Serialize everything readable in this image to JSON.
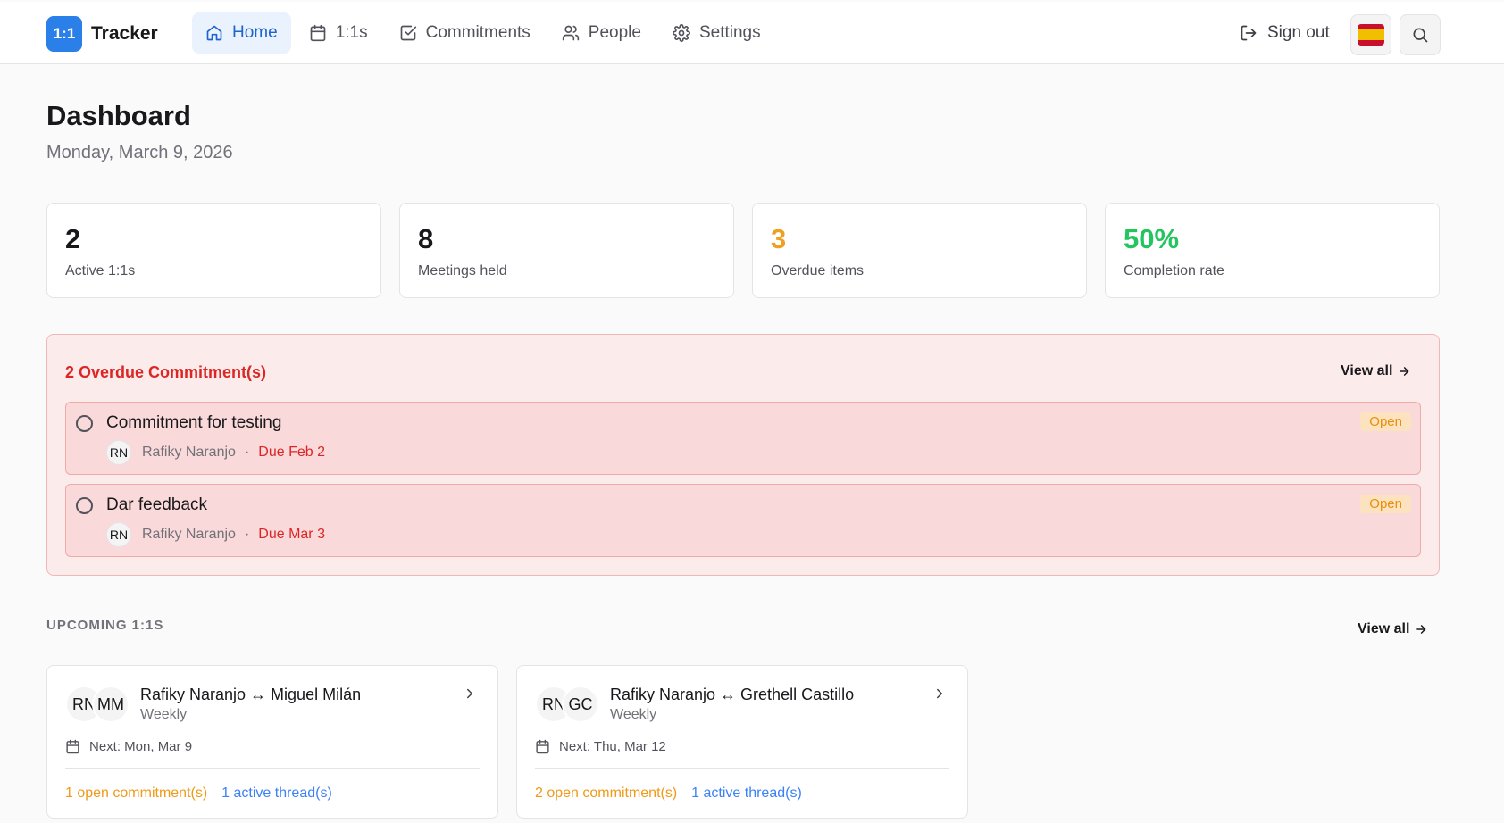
{
  "brand": {
    "logo_text": "1:1",
    "name": "Tracker"
  },
  "nav": [
    {
      "label": "Home",
      "icon": "home-icon",
      "active": true
    },
    {
      "label": "1:1s",
      "icon": "calendar-icon",
      "active": false
    },
    {
      "label": "Commitments",
      "icon": "checkbox-icon",
      "active": false
    },
    {
      "label": "People",
      "icon": "users-icon",
      "active": false
    },
    {
      "label": "Settings",
      "icon": "gear-icon",
      "active": false
    }
  ],
  "header": {
    "sign_out": "Sign out",
    "language_flag": "spain-flag-icon",
    "search_icon": "search-icon"
  },
  "page": {
    "title": "Dashboard",
    "date": "Monday, March 9, 2026"
  },
  "stats": [
    {
      "value": "2",
      "label": "Active 1:1s",
      "color": "#18181b"
    },
    {
      "value": "8",
      "label": "Meetings held",
      "color": "#18181b"
    },
    {
      "value": "3",
      "label": "Overdue items",
      "color": "#f0a020"
    },
    {
      "value": "50%",
      "label": "Completion rate",
      "color": "#22c55e"
    }
  ],
  "overdue": {
    "title": "2 Overdue Commitment(s)",
    "view_all": "View all",
    "items": [
      {
        "title": "Commitment for testing",
        "initials": "RN",
        "person": "Rafiky Naranjo",
        "separator": "·",
        "due": "Due Feb 2",
        "status": "Open"
      },
      {
        "title": "Dar feedback",
        "initials": "RN",
        "person": "Rafiky Naranjo",
        "separator": "·",
        "due": "Due Mar 3",
        "status": "Open"
      }
    ]
  },
  "upcoming": {
    "title": "UPCOMING 1:1S",
    "view_all": "View all",
    "cards": [
      {
        "initials_a": "RN",
        "initials_b": "MM",
        "pair": "Rafiky Naranjo ↔ Miguel Milán",
        "frequency": "Weekly",
        "next": "Next: Mon, Mar 9",
        "open": "1 open commitment(s)",
        "threads": "1 active thread(s)"
      },
      {
        "initials_a": "RN",
        "initials_b": "GC",
        "pair": "Rafiky Naranjo ↔ Grethell Castillo",
        "frequency": "Weekly",
        "next": "Next: Thu, Mar 12",
        "open": "2 open commitment(s)",
        "threads": "1 active thread(s)"
      }
    ]
  },
  "colors": {
    "accent": "#2b7fe8",
    "danger": "#dc2626",
    "warning": "#f09a19",
    "success": "#22c55e",
    "link": "#3b82f6"
  }
}
